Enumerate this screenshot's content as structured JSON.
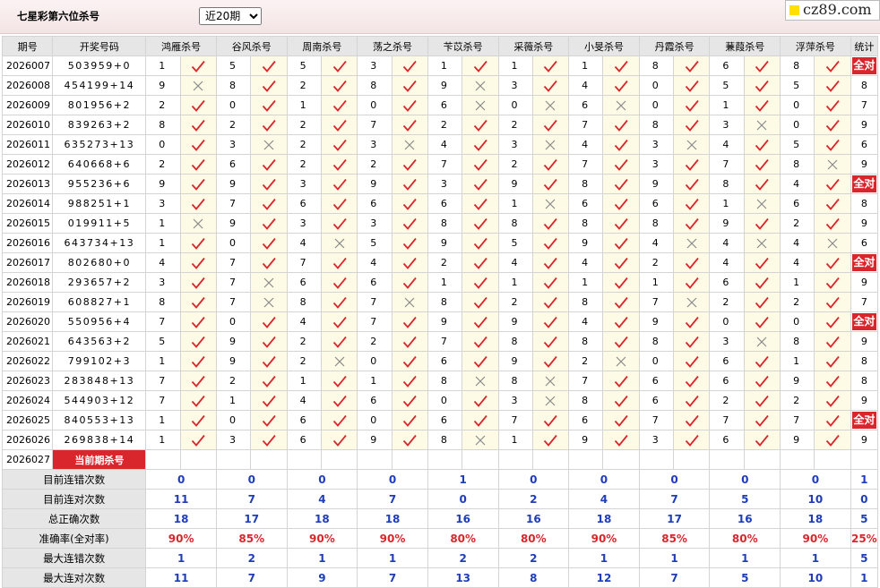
{
  "page": {
    "title": "七星彩第六位杀号",
    "period_select": "近20期",
    "site": "cz89.com"
  },
  "colors": {
    "accent_red": "#d9262c",
    "blue": "#1f3db8",
    "mark_bg": "#fdfbe6"
  },
  "headers": {
    "issue": "期号",
    "numbers": "开奖号码",
    "experts": [
      "鸿雁杀号",
      "谷风杀号",
      "周南杀号",
      "荡之杀号",
      "苄苡杀号",
      "采薇杀号",
      "小旻杀号",
      "丹霞杀号",
      "蒹葭杀号",
      "浮萍杀号"
    ],
    "stat": "统计"
  },
  "rows": [
    {
      "issue": "2026007",
      "nums": "503959+0",
      "kills": [
        1,
        5,
        5,
        3,
        1,
        1,
        1,
        8,
        6,
        8
      ],
      "ok": [
        1,
        1,
        1,
        1,
        1,
        1,
        1,
        1,
        1,
        1
      ],
      "stat": "全对"
    },
    {
      "issue": "2026008",
      "nums": "454199+14",
      "kills": [
        9,
        8,
        2,
        8,
        9,
        3,
        4,
        0,
        5,
        5
      ],
      "ok": [
        0,
        1,
        1,
        1,
        0,
        1,
        1,
        1,
        1,
        1
      ],
      "stat": "8"
    },
    {
      "issue": "2026009",
      "nums": "801956+2",
      "kills": [
        2,
        0,
        1,
        0,
        6,
        0,
        6,
        0,
        1,
        0
      ],
      "ok": [
        1,
        1,
        1,
        1,
        0,
        0,
        0,
        1,
        1,
        1
      ],
      "stat": "7"
    },
    {
      "issue": "2026010",
      "nums": "839263+2",
      "kills": [
        8,
        2,
        2,
        7,
        2,
        2,
        7,
        8,
        3,
        0
      ],
      "ok": [
        1,
        1,
        1,
        1,
        1,
        1,
        1,
        1,
        0,
        1
      ],
      "stat": "9"
    },
    {
      "issue": "2026011",
      "nums": "635273+13",
      "kills": [
        0,
        3,
        2,
        3,
        4,
        3,
        4,
        3,
        4,
        5
      ],
      "ok": [
        1,
        0,
        1,
        0,
        1,
        0,
        1,
        0,
        1,
        1
      ],
      "stat": "6"
    },
    {
      "issue": "2026012",
      "nums": "640668+6",
      "kills": [
        2,
        6,
        2,
        2,
        7,
        2,
        7,
        3,
        7,
        8
      ],
      "ok": [
        1,
        1,
        1,
        1,
        1,
        1,
        1,
        1,
        1,
        0
      ],
      "stat": "9"
    },
    {
      "issue": "2026013",
      "nums": "955236+6",
      "kills": [
        9,
        9,
        3,
        9,
        3,
        9,
        8,
        9,
        8,
        4
      ],
      "ok": [
        1,
        1,
        1,
        1,
        1,
        1,
        1,
        1,
        1,
        1
      ],
      "stat": "全对"
    },
    {
      "issue": "2026014",
      "nums": "988251+1",
      "kills": [
        3,
        7,
        6,
        6,
        6,
        1,
        6,
        6,
        1,
        6
      ],
      "ok": [
        1,
        1,
        1,
        1,
        1,
        0,
        1,
        1,
        0,
        1
      ],
      "stat": "8"
    },
    {
      "issue": "2026015",
      "nums": "019911+5",
      "kills": [
        1,
        9,
        3,
        3,
        8,
        8,
        8,
        8,
        9,
        2
      ],
      "ok": [
        0,
        1,
        1,
        1,
        1,
        1,
        1,
        1,
        1,
        1
      ],
      "stat": "9"
    },
    {
      "issue": "2026016",
      "nums": "643734+13",
      "kills": [
        1,
        0,
        4,
        5,
        9,
        5,
        9,
        4,
        4,
        4
      ],
      "ok": [
        1,
        1,
        0,
        1,
        1,
        1,
        1,
        0,
        0,
        0
      ],
      "stat": "6"
    },
    {
      "issue": "2026017",
      "nums": "802680+0",
      "kills": [
        4,
        7,
        7,
        4,
        2,
        4,
        4,
        2,
        4,
        4
      ],
      "ok": [
        1,
        1,
        1,
        1,
        1,
        1,
        1,
        1,
        1,
        1
      ],
      "stat": "全对"
    },
    {
      "issue": "2026018",
      "nums": "293657+2",
      "kills": [
        3,
        7,
        6,
        6,
        1,
        1,
        1,
        1,
        6,
        1
      ],
      "ok": [
        1,
        0,
        1,
        1,
        1,
        1,
        1,
        1,
        1,
        1
      ],
      "stat": "9"
    },
    {
      "issue": "2026019",
      "nums": "608827+1",
      "kills": [
        8,
        7,
        8,
        7,
        8,
        2,
        8,
        7,
        2,
        2
      ],
      "ok": [
        1,
        0,
        1,
        0,
        1,
        1,
        1,
        0,
        1,
        1
      ],
      "stat": "7"
    },
    {
      "issue": "2026020",
      "nums": "550956+4",
      "kills": [
        7,
        0,
        4,
        7,
        9,
        9,
        4,
        9,
        0,
        0
      ],
      "ok": [
        1,
        1,
        1,
        1,
        1,
        1,
        1,
        1,
        1,
        1
      ],
      "stat": "全对"
    },
    {
      "issue": "2026021",
      "nums": "643563+2",
      "kills": [
        5,
        9,
        2,
        2,
        7,
        8,
        8,
        8,
        3,
        8
      ],
      "ok": [
        1,
        1,
        1,
        1,
        1,
        1,
        1,
        1,
        0,
        1
      ],
      "stat": "9"
    },
    {
      "issue": "2026022",
      "nums": "799102+3",
      "kills": [
        1,
        9,
        2,
        0,
        6,
        9,
        2,
        0,
        6,
        1
      ],
      "ok": [
        1,
        1,
        0,
        1,
        1,
        1,
        0,
        1,
        1,
        1
      ],
      "stat": "8"
    },
    {
      "issue": "2026023",
      "nums": "283848+13",
      "kills": [
        7,
        2,
        1,
        1,
        8,
        8,
        7,
        6,
        6,
        9
      ],
      "ok": [
        1,
        1,
        1,
        1,
        0,
        0,
        1,
        1,
        1,
        1
      ],
      "stat": "8"
    },
    {
      "issue": "2026024",
      "nums": "544903+12",
      "kills": [
        7,
        1,
        4,
        6,
        0,
        3,
        8,
        6,
        2,
        2
      ],
      "ok": [
        1,
        1,
        1,
        1,
        1,
        0,
        1,
        1,
        1,
        1
      ],
      "stat": "9"
    },
    {
      "issue": "2026025",
      "nums": "840553+13",
      "kills": [
        1,
        0,
        6,
        0,
        6,
        7,
        6,
        7,
        7,
        7
      ],
      "ok": [
        1,
        1,
        1,
        1,
        1,
        1,
        1,
        1,
        1,
        1
      ],
      "stat": "全对"
    },
    {
      "issue": "2026026",
      "nums": "269838+14",
      "kills": [
        1,
        3,
        6,
        9,
        8,
        1,
        9,
        3,
        6,
        9
      ],
      "ok": [
        1,
        1,
        1,
        1,
        0,
        1,
        1,
        1,
        1,
        1
      ],
      "stat": "9"
    }
  ],
  "current": {
    "issue": "2026027",
    "label": "当前期杀号",
    "kills": [
      "8",
      "2",
      "3",
      "4",
      "3",
      "9",
      "9",
      "0",
      "1",
      "7"
    ]
  },
  "footer": [
    {
      "label": "目前连错次数",
      "values": [
        "0",
        "0",
        "0",
        "0",
        "1",
        "0",
        "0",
        "0",
        "0",
        "0",
        "1"
      ],
      "red": false
    },
    {
      "label": "目前连对次数",
      "values": [
        "11",
        "7",
        "4",
        "7",
        "0",
        "2",
        "4",
        "7",
        "5",
        "10",
        "0"
      ],
      "red": false
    },
    {
      "label": "总正确次数",
      "values": [
        "18",
        "17",
        "18",
        "18",
        "16",
        "16",
        "18",
        "17",
        "16",
        "18",
        "5"
      ],
      "red": false
    },
    {
      "label": "准确率(全对率)",
      "values": [
        "90%",
        "85%",
        "90%",
        "90%",
        "80%",
        "80%",
        "90%",
        "85%",
        "80%",
        "90%",
        "25%"
      ],
      "red": true
    },
    {
      "label": "最大连错次数",
      "values": [
        "1",
        "2",
        "1",
        "1",
        "2",
        "2",
        "1",
        "1",
        "1",
        "1",
        "5"
      ],
      "red": false
    },
    {
      "label": "最大连对次数",
      "values": [
        "11",
        "7",
        "9",
        "7",
        "13",
        "8",
        "12",
        "7",
        "5",
        "10",
        "1"
      ],
      "red": false
    }
  ]
}
